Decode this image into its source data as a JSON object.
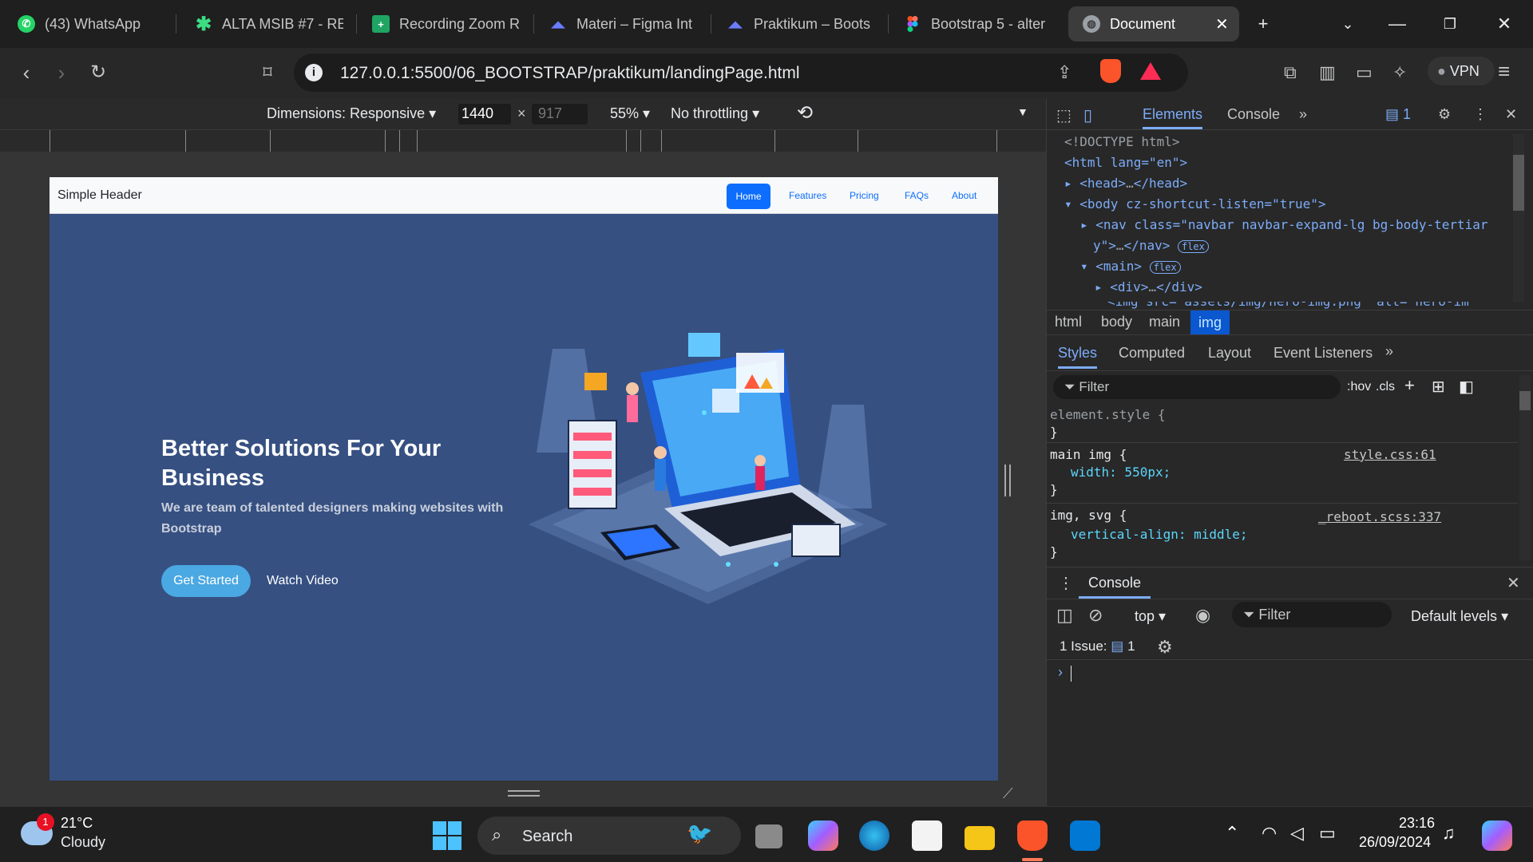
{
  "browser": {
    "tabs": [
      {
        "title": "(43) WhatsApp",
        "icon": "whatsapp-icon",
        "color": "#25d366"
      },
      {
        "title": "ALTA MSIB #7 - RE",
        "icon": "asterisk-icon",
        "color": "#3ddc84"
      },
      {
        "title": "Recording Zoom R",
        "icon": "sheets-icon",
        "color": "#1fa463"
      },
      {
        "title": "Materi – Figma Int",
        "icon": "alterra-icon",
        "color": "#6a7dff"
      },
      {
        "title": "Praktikum – Boots",
        "icon": "alterra-icon",
        "color": "#6a7dff"
      },
      {
        "title": "Bootstrap 5 - alter",
        "icon": "figma-icon",
        "color": "#f24e1e"
      },
      {
        "title": "Document",
        "icon": "globe-icon",
        "color": "#9aa0a6"
      }
    ],
    "url": "127.0.0.1:5500/06_BOOTSTRAP/praktikum/landingPage.html",
    "vpn_label": "VPN"
  },
  "device_toolbar": {
    "dimensions": "Dimensions: Responsive",
    "width": "1440",
    "height": "917",
    "times": "×",
    "zoom": "55%",
    "throttling": "No throttling"
  },
  "page": {
    "brand": "Simple Header",
    "nav": [
      "Home",
      "Features",
      "Pricing",
      "FAQs",
      "About"
    ],
    "hero_title": "Better Solutions For Your Business",
    "hero_sub": "We are team of talented designers making websites with Bootstrap",
    "btn_start": "Get Started",
    "btn_watch": "Watch Video",
    "bg_color": "#365082"
  },
  "devtools": {
    "tabs": [
      "Elements",
      "Console"
    ],
    "issues_count": "1",
    "dom": [
      "<!DOCTYPE html>",
      "<html lang=\"en\">",
      "<head>",
      "</head>",
      "<body cz-shortcut-listen=\"true\">",
      "<nav class=\"navbar navbar-expand-lg bg-body-tertiar",
      "y\">",
      "</nav>",
      "<main>",
      "<div>",
      "</div>",
      "<img src=\"assets/img/hero-img.png\" alt=\"hero-im"
    ],
    "flex_badge": "flex",
    "breadcrumbs": [
      "html",
      "body",
      "main",
      "img"
    ],
    "style_tabs": [
      "Styles",
      "Computed",
      "Layout",
      "Event Listeners"
    ],
    "filter": "Filter",
    "hov": ":hov",
    "cls": ".cls",
    "rules": [
      {
        "selector": "element.style {",
        "decls": [],
        "close": "}",
        "source": ""
      },
      {
        "selector": "main img {",
        "decls": [
          "width: 550px;"
        ],
        "close": "}",
        "source": "style.css:61"
      },
      {
        "selector": "img, svg {",
        "decls": [
          "vertical-align: middle;"
        ],
        "close": "}",
        "source": "_reboot.scss:337"
      }
    ],
    "console": {
      "title": "Console",
      "context": "top",
      "filter": "Filter",
      "levels": "Default levels",
      "issues_label": "1 Issue:",
      "issues_count": "1"
    }
  },
  "taskbar": {
    "weather_temp": "21°C",
    "weather_desc": "Cloudy",
    "weather_badge": "1",
    "search": "Search",
    "time": "23:16",
    "date": "26/09/2024"
  }
}
